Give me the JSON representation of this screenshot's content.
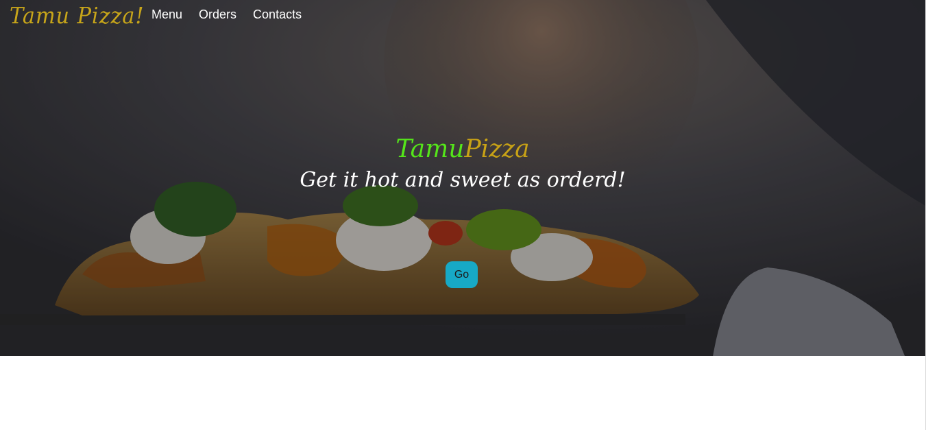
{
  "brand": {
    "name": "Tamu Pizza!"
  },
  "nav": {
    "items": [
      {
        "label": "Menu"
      },
      {
        "label": "Orders"
      },
      {
        "label": "Contacts"
      }
    ]
  },
  "hero": {
    "title_part1": "Tamu",
    "title_part2": "Pizza",
    "subtitle": "Get it hot and sweet as orderd!",
    "button_label": "Go",
    "background": "photo of a chef holding a slice of pizza on a peel (dark overlay)"
  },
  "colors": {
    "brand_gold": "#c7a51a",
    "title_green": "#55e61a",
    "button_cyan": "#17a9c6"
  }
}
